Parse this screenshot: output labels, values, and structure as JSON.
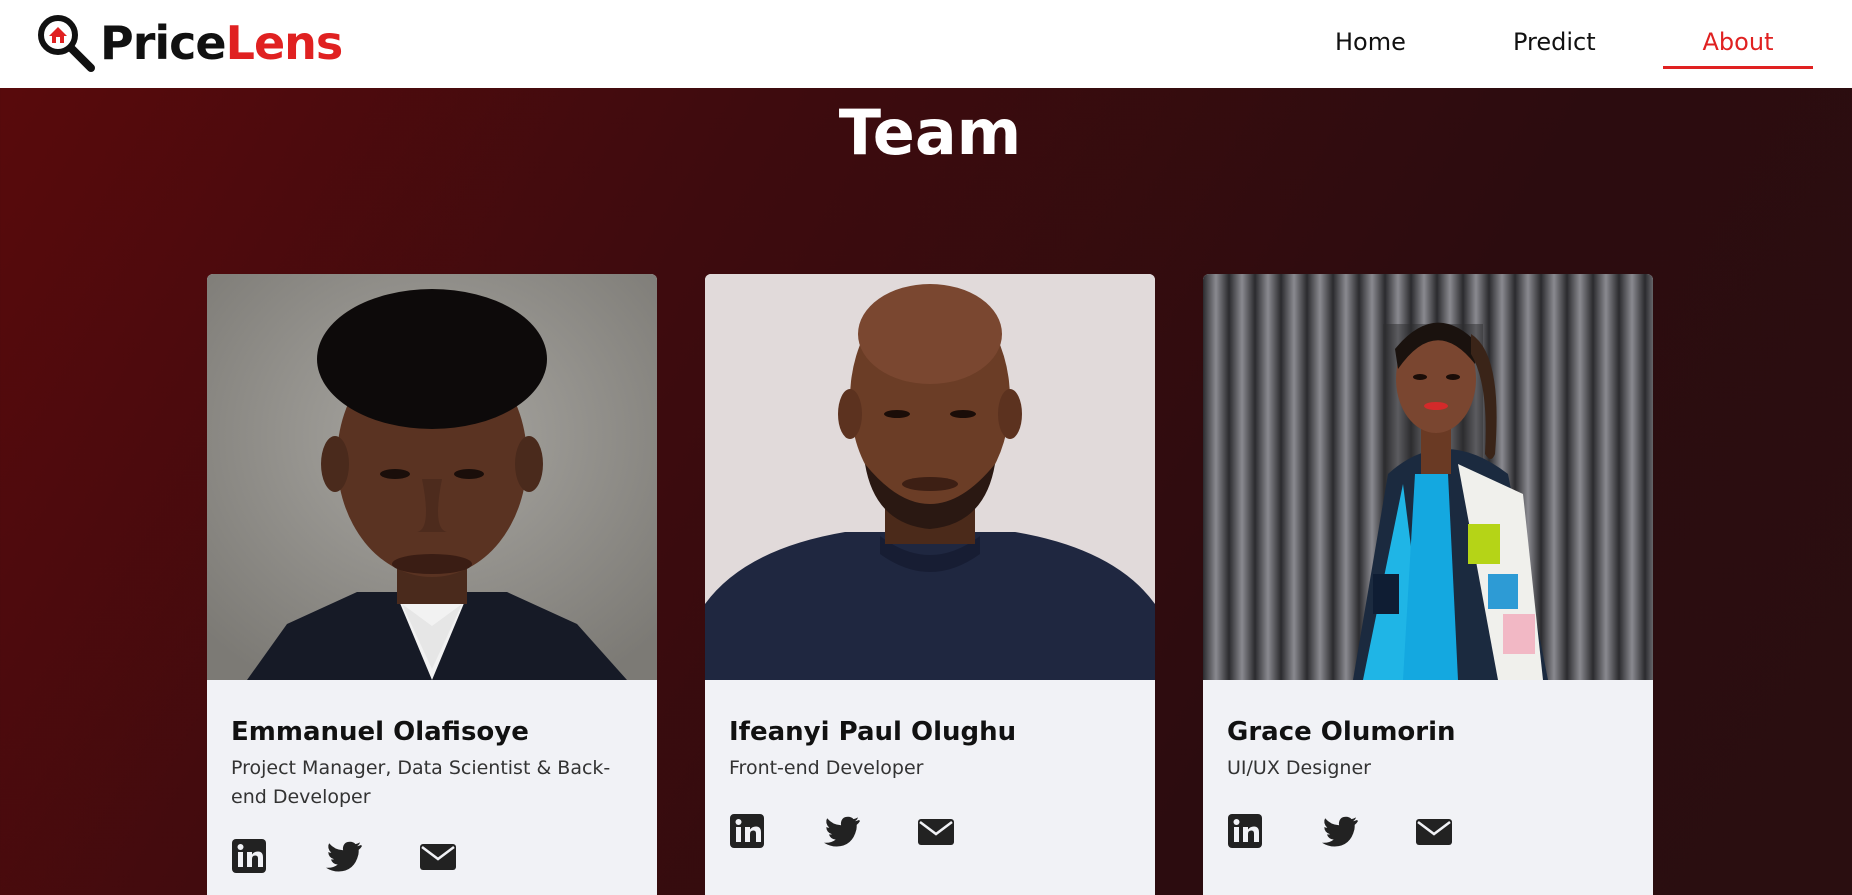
{
  "brand": {
    "part1": "Price",
    "part2": "Lens"
  },
  "nav": {
    "home": "Home",
    "predict": "Predict",
    "about": "About",
    "active": "About"
  },
  "section": {
    "title": "Team"
  },
  "team": [
    {
      "name": "Emmanuel Olafisoye",
      "role": "Project Manager, Data Scientist & Back-end Developer",
      "photo_icon": "portrait-photo"
    },
    {
      "name": "Ifeanyi Paul Olughu",
      "role": "Front-end Developer",
      "photo_icon": "portrait-photo"
    },
    {
      "name": "Grace Olumorin",
      "role": "UI/UX Designer",
      "photo_icon": "portrait-photo"
    }
  ],
  "social_icons": [
    "linkedin-icon",
    "twitter-icon",
    "email-icon"
  ],
  "colors": {
    "accent": "#e02121",
    "background": "#3e0b0e",
    "card": "#f1f2f6",
    "text": "#111111"
  }
}
